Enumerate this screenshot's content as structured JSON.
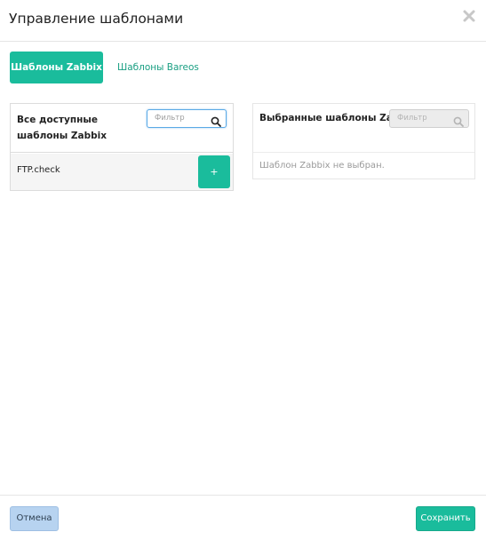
{
  "modal": {
    "title": "Управление шаблонами",
    "close_icon": "close-icon"
  },
  "tabs": [
    {
      "label": "Шаблоны Zabbix",
      "active": true
    },
    {
      "label": "Шаблоны Bareos",
      "active": false
    }
  ],
  "available": {
    "title": "Все доступные шаблоны Zabbix",
    "filter_placeholder": "Фильтр",
    "items": [
      {
        "label": "FTP.check",
        "add_label": "+"
      }
    ]
  },
  "selected": {
    "title": "Выбранные шаблоны Zabbix",
    "filter_placeholder": "Фильтр",
    "empty_message": "Шаблон Zabbix не выбран."
  },
  "footer": {
    "cancel_label": "Отмена",
    "save_label": "Сохранить"
  },
  "colors": {
    "accent": "#1abc9c",
    "cancel_bg": "#b7d3f0",
    "focus_border": "#5aa9e6"
  }
}
